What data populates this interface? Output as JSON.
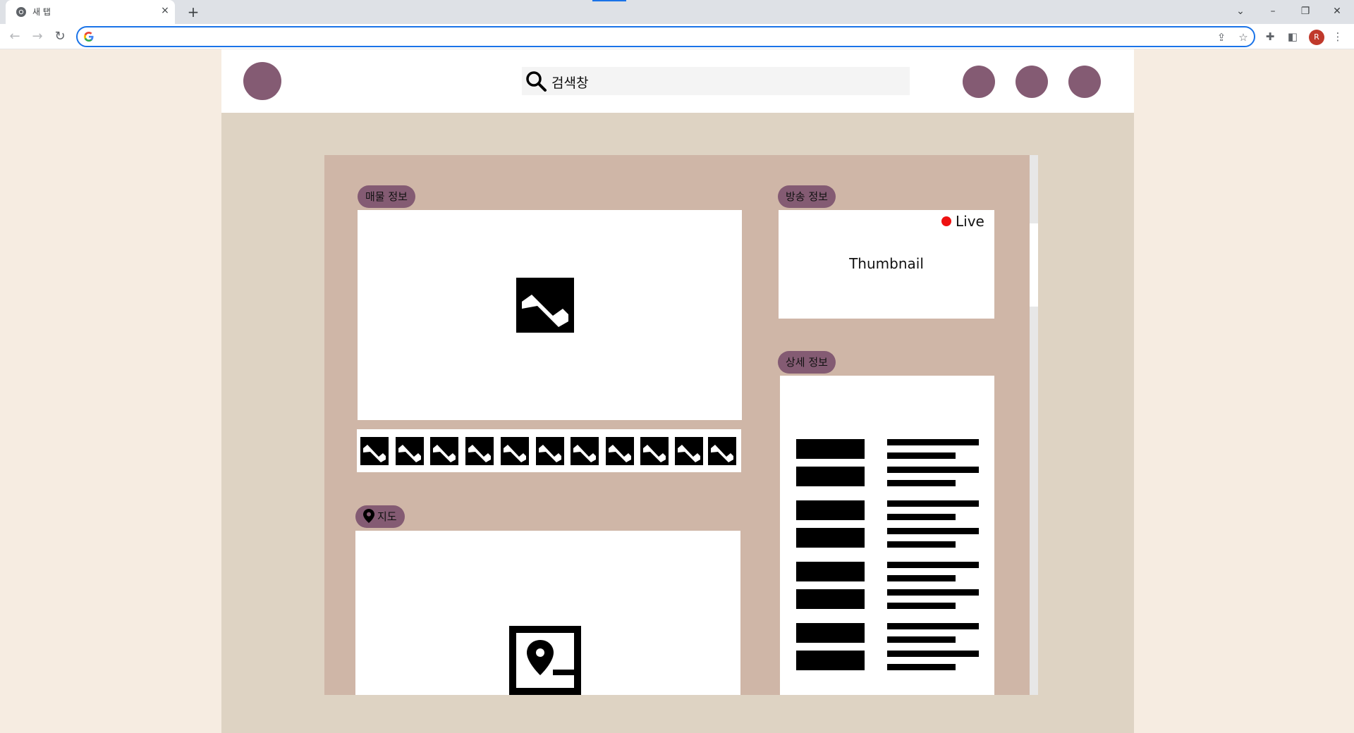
{
  "browser": {
    "tab_title": "새 탭",
    "tab_close": "×",
    "new_tab": "+",
    "window_controls": {
      "tab_search": "⌄",
      "minimize": "–",
      "restore": "❐",
      "close": "✕"
    },
    "nav": {
      "back": "←",
      "forward": "→",
      "reload": "↻"
    },
    "omnibox": {
      "value": "",
      "placeholder": ""
    },
    "icons": {
      "share": "⇪",
      "star": "☆",
      "extensions": "✚",
      "sidepanel": "◧",
      "menu": "⋮"
    },
    "profile_initial": "R",
    "profile_color": "#c0392b",
    "accent": "#1a73e8"
  },
  "site": {
    "search_text": "검색창",
    "brand_color": "#845b73",
    "panel_color": "#cfb6a7",
    "page_bg": "#ded3c3"
  },
  "sections": {
    "property_info": "매물 정보",
    "broadcast_info": "방송 정보",
    "detail_info": "상세 정보",
    "map": "지도"
  },
  "broadcast": {
    "live_label": "Live",
    "thumbnail_label": "Thumbnail"
  },
  "gallery_thumbnail_count": 11
}
